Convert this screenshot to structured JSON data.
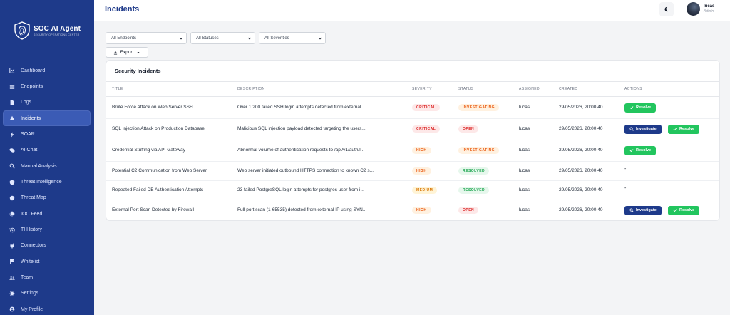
{
  "brand": {
    "name": "SOC AI Agent",
    "sub": "SECURITY OPERATIONS CENTER"
  },
  "sidebar": {
    "items": [
      {
        "label": "Dashboard",
        "icon": "chart-line-icon"
      },
      {
        "label": "Endpoints",
        "icon": "server-icon"
      },
      {
        "label": "Logs",
        "icon": "file-icon"
      },
      {
        "label": "Incidents",
        "icon": "warning-icon",
        "active": true
      },
      {
        "label": "SOAR",
        "icon": "bolt-icon"
      },
      {
        "label": "AI Chat",
        "icon": "chat-icon"
      },
      {
        "label": "Manual Analysis",
        "icon": "search-icon"
      },
      {
        "label": "Threat Intelligence",
        "icon": "shield-icon"
      },
      {
        "label": "Threat Map",
        "icon": "globe-icon"
      },
      {
        "label": "IOC Feed",
        "icon": "virus-icon"
      },
      {
        "label": "TI History",
        "icon": "history-icon"
      },
      {
        "label": "Connectors",
        "icon": "plug-icon"
      },
      {
        "label": "Whitelist",
        "icon": "flag-icon"
      },
      {
        "label": "Team",
        "icon": "users-icon"
      },
      {
        "label": "Settings",
        "icon": "gear-icon"
      },
      {
        "label": "My Profile",
        "icon": "user-circle-icon"
      }
    ]
  },
  "header": {
    "title": "Incidents",
    "theme_icon": "moon-icon"
  },
  "user": {
    "name": "lucas",
    "role": "Admin"
  },
  "filters": {
    "endpoints": "All Endpoints",
    "statuses": "All Statuses",
    "severities": "All Severities"
  },
  "export": {
    "label": "Export"
  },
  "card": {
    "title": "Security Incidents"
  },
  "table": {
    "headers": [
      "TITLE",
      "DESCRIPTION",
      "SEVERITY",
      "STATUS",
      "ASSIGNED",
      "CREATED",
      "ACTIONS"
    ],
    "rows": [
      {
        "title": "Brute Force Attack on Web Server SSH",
        "description": "Over 1,200 failed SSH login attempts detected from external ...",
        "severity": "CRITICAL",
        "status": "INVESTIGATING",
        "assigned": "lucas",
        "created": "29/05/2026, 20:00:40",
        "actions": [
          "Resolve"
        ]
      },
      {
        "title": "SQL Injection Attack on Production Database",
        "description": "Malicious SQL injection payload detected targeting the users...",
        "severity": "CRITICAL",
        "status": "OPEN",
        "assigned": "lucas",
        "created": "29/05/2026, 20:00:40",
        "actions": [
          "Investigate",
          "Resolve"
        ]
      },
      {
        "title": "Credential Stuffing via API Gateway",
        "description": "Abnormal volume of authentication requests to /api/v1/auth/l...",
        "severity": "HIGH",
        "status": "INVESTIGATING",
        "assigned": "lucas",
        "created": "29/05/2026, 20:00:40",
        "actions": [
          "Resolve"
        ]
      },
      {
        "title": "Potential C2 Communication from Web Server",
        "description": "Web server initiated outbound HTTPS connection to known C2 s...",
        "severity": "HIGH",
        "status": "RESOLVED",
        "assigned": "lucas",
        "created": "29/05/2026, 20:00:40",
        "actions": [],
        "empty_action": "-"
      },
      {
        "title": "Repeated Failed DB Authentication Attempts",
        "description": "23 failed PostgreSQL login attempts for postgres user from i...",
        "severity": "MEDIUM",
        "status": "RESOLVED",
        "assigned": "lucas",
        "created": "29/05/2026, 20:00:40",
        "actions": [],
        "empty_action": "-"
      },
      {
        "title": "External Port Scan Detected by Firewall",
        "description": "Full port scan (1-65535) detected from external IP using SYN...",
        "severity": "HIGH",
        "status": "OPEN",
        "assigned": "lucas",
        "created": "29/05/2026, 20:00:40",
        "actions": [
          "Investigate",
          "Resolve"
        ]
      }
    ]
  },
  "colors": {
    "sidebar": "#1e3a8a",
    "critical_bg": "#fde8e8",
    "critical_fg": "#dc2626",
    "high_bg": "#fff1e0",
    "high_fg": "#ea580c",
    "medium_bg": "#fff4d6",
    "medium_fg": "#d97706",
    "investigating_bg": "#fff1e0",
    "investigating_fg": "#ea580c",
    "open_bg": "#fde8e8",
    "open_fg": "#dc2626",
    "resolved_bg": "#e6f7ec",
    "resolved_fg": "#16a34a",
    "investigate_btn": "#1e3a8a",
    "resolve_btn": "#22c55e"
  }
}
